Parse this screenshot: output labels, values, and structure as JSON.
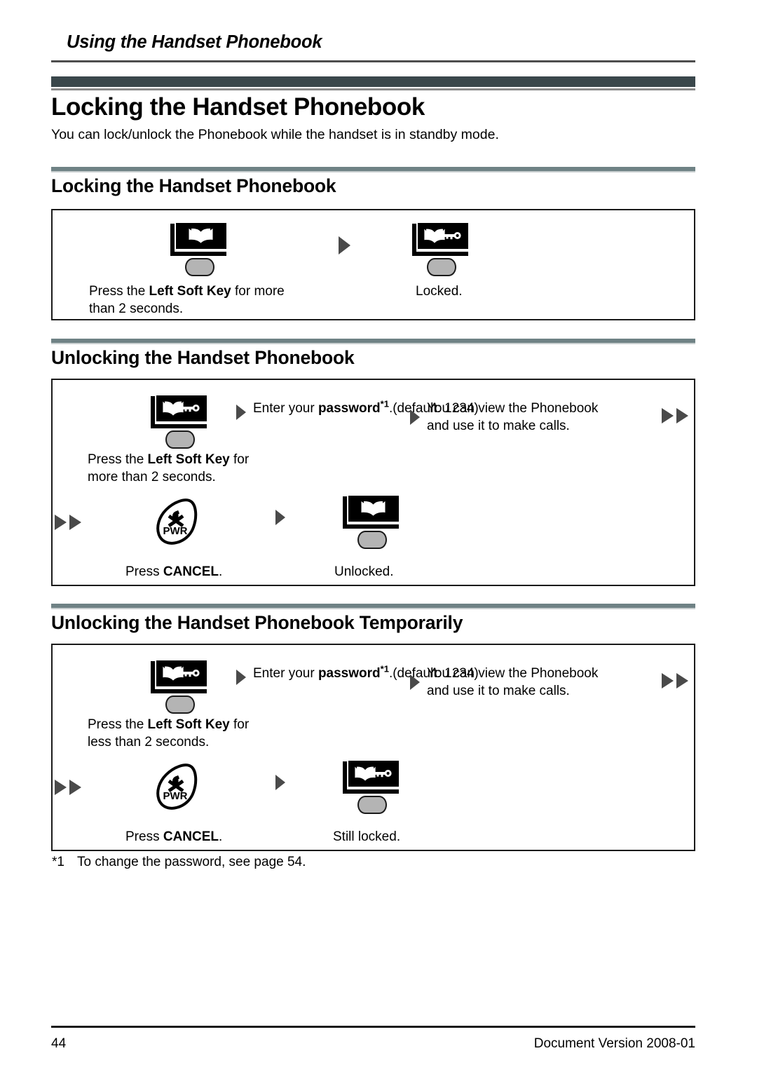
{
  "header": {
    "running_title": "Using the Handset Phonebook"
  },
  "chapter": {
    "title": "Locking the Handset Phonebook",
    "intro": "You can lock/unlock the Phonebook while the handset is in standby mode."
  },
  "sections": [
    {
      "title": "Locking the Handset Phonebook",
      "steps": [
        {
          "icon": "handset-phonebook-unlocked-icon",
          "caption_parts": [
            "Press the ",
            "Left Soft Key",
            " for more\nthan 2 seconds."
          ]
        },
        {
          "icon": "handset-phonebook-locked-icon",
          "caption_parts": [
            "Locked."
          ]
        }
      ]
    },
    {
      "title": "Unlocking the Handset Phonebook",
      "steps": [
        {
          "icon": "handset-phonebook-locked-icon",
          "caption_parts": [
            "Press the ",
            "Left Soft Key",
            " for\nmore than 2 seconds."
          ]
        },
        {
          "icon": "text-step",
          "caption_parts": [
            "Enter your ",
            "password",
            "*1",
            ".\n(default: 1234)"
          ]
        },
        {
          "icon": "text-step",
          "caption_parts": [
            "You can view the Phonebook\nand use it to make calls."
          ]
        },
        {
          "icon": "power-cancel-key-icon",
          "caption_parts": [
            "Press ",
            "CANCEL",
            "."
          ]
        },
        {
          "icon": "handset-phonebook-unlocked-icon",
          "caption_parts": [
            "Unlocked."
          ]
        }
      ]
    },
    {
      "title": "Unlocking the Handset Phonebook Temporarily",
      "steps": [
        {
          "icon": "handset-phonebook-locked-icon",
          "caption_parts": [
            "Press the ",
            "Left Soft Key",
            " for\nless than 2 seconds."
          ]
        },
        {
          "icon": "text-step",
          "caption_parts": [
            "Enter your ",
            "password",
            "*1",
            ".\n(default: 1234)"
          ]
        },
        {
          "icon": "text-step",
          "caption_parts": [
            "You can view the Phonebook\nand use it to make calls."
          ]
        },
        {
          "icon": "power-cancel-key-icon",
          "caption_parts": [
            "Press ",
            "CANCEL",
            "."
          ]
        },
        {
          "icon": "handset-phonebook-locked-icon",
          "caption_parts": [
            "Still locked."
          ]
        }
      ]
    }
  ],
  "labels": {
    "press_the": "Press the ",
    "left_soft_key": "Left Soft Key",
    "for_more_than_2_seconds": " for more\nthan 2 seconds.",
    "for_more_than_2_seconds_b": " for\nmore than 2 seconds.",
    "for_less_than_2_seconds": " for\nless than 2 seconds.",
    "locked": "Locked.",
    "unlocked": "Unlocked.",
    "still_locked": "Still locked.",
    "enter_your": "Enter your ",
    "password": "password",
    "password_footnote_mark": "*1",
    "password_period": ".",
    "default_1234": "(default: 1234)",
    "view_phonebook": "You can view the Phonebook\nand use it to make calls.",
    "press": "Press ",
    "cancel": "CANCEL",
    "cancel_period": ".",
    "pwr_key_text": "PWR"
  },
  "footnote": {
    "mark": "*1",
    "text": "To change the password, see page 54."
  },
  "footer": {
    "page_number": "44",
    "document_version": "Document Version 2008-01"
  },
  "colors": {
    "chapter_bar": "#3a474b",
    "section_rule": "#6f8285",
    "arrow": "#4a4a4a",
    "softkey_fill": "#b4b4b4",
    "box_border": "#1a1a1a"
  }
}
